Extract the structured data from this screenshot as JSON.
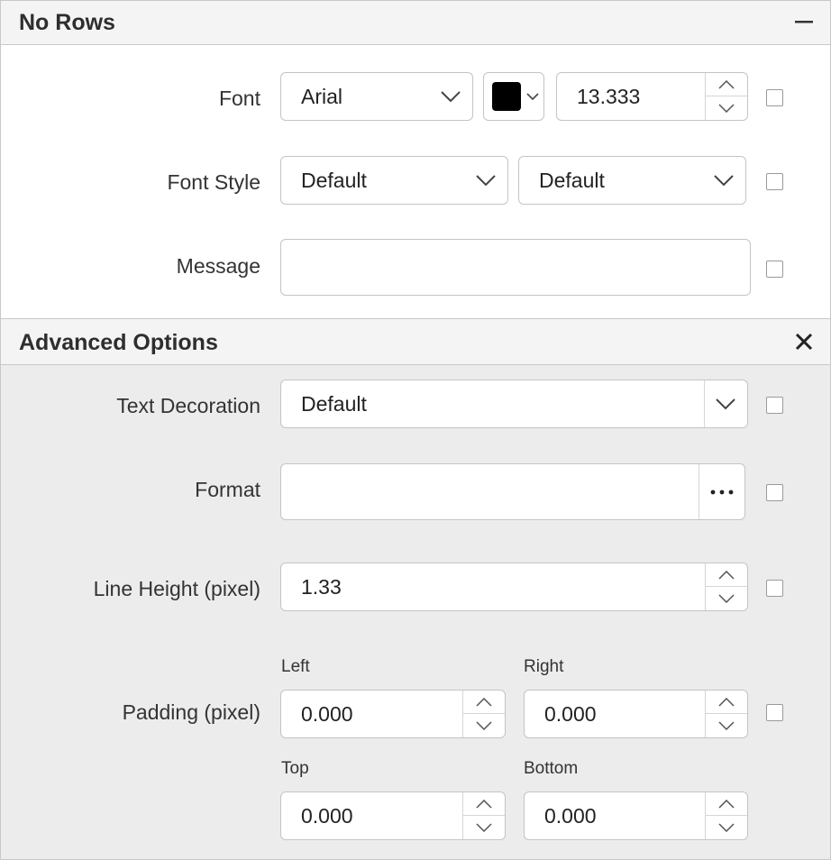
{
  "no_rows": {
    "title": "No Rows",
    "font": {
      "label": "Font",
      "family": "Arial",
      "color": "#000000",
      "size": "13.333"
    },
    "font_style": {
      "label": "Font Style",
      "style": "Default",
      "weight": "Default"
    },
    "message": {
      "label": "Message",
      "value": ""
    }
  },
  "advanced": {
    "title": "Advanced Options",
    "text_decoration": {
      "label": "Text Decoration",
      "value": "Default"
    },
    "format": {
      "label": "Format",
      "value": ""
    },
    "line_height": {
      "label": "Line Height (pixel)",
      "value": "1.33"
    },
    "padding": {
      "label": "Padding (pixel)",
      "left_label": "Left",
      "left": "0.000",
      "right_label": "Right",
      "right": "0.000",
      "top_label": "Top",
      "top": "0.000",
      "bottom_label": "Bottom",
      "bottom": "0.000"
    }
  },
  "colors": {
    "section_bg": "#ffffff",
    "advanced_bg": "#ececec",
    "header_bg": "#f4f4f4"
  }
}
